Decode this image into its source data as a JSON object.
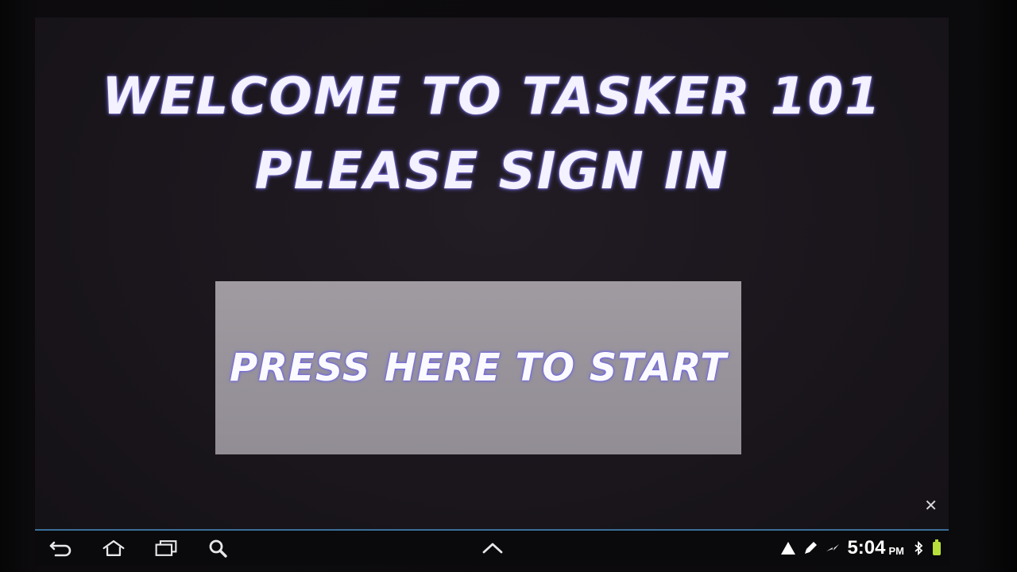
{
  "screen": {
    "title_line1": "WELCOME TO TASKER 101",
    "title_line2": "PLEASE SIGN IN",
    "start_button_label": "PRESS HERE TO START",
    "close_glyph": "✕"
  },
  "system_bar": {
    "nav_icons": [
      "back-icon",
      "home-icon",
      "recent-apps-icon",
      "search-icon"
    ],
    "center_icon": "chevron-up-icon",
    "status_icons": [
      "warning-icon",
      "pencil-icon",
      "usb-icon",
      "bluetooth-icon",
      "battery-icon"
    ],
    "clock": "5:04",
    "ampm": "PM"
  },
  "colors": {
    "screen_bg": "#1a161c",
    "button_bg": "#9a959c",
    "title_text": "#f4f2ff",
    "text_glow": "#7a70ff",
    "bar_accent": "#3a6f9a",
    "battery": "#b7e03a"
  }
}
